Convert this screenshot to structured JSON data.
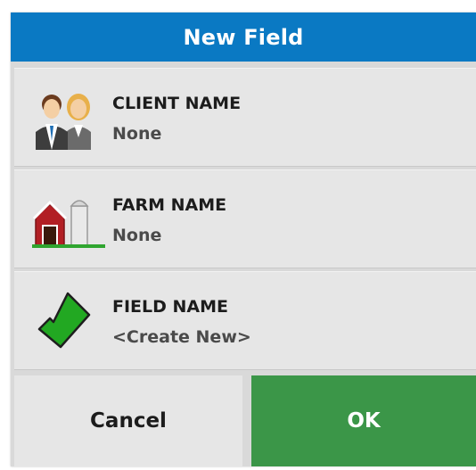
{
  "dialog": {
    "title": "New Field"
  },
  "rows": [
    {
      "label": "CLIENT NAME",
      "value": "None",
      "icon": "client-people-icon"
    },
    {
      "label": "FARM NAME",
      "value": "None",
      "icon": "farm-barn-icon"
    },
    {
      "label": "FIELD NAME",
      "value": "<Create New>",
      "icon": "field-shape-icon"
    }
  ],
  "buttons": {
    "cancel": "Cancel",
    "ok": "OK"
  },
  "colors": {
    "title_bar": "#0a79c3",
    "ok_button": "#3b9648",
    "row_background": "#e6e6e6"
  }
}
